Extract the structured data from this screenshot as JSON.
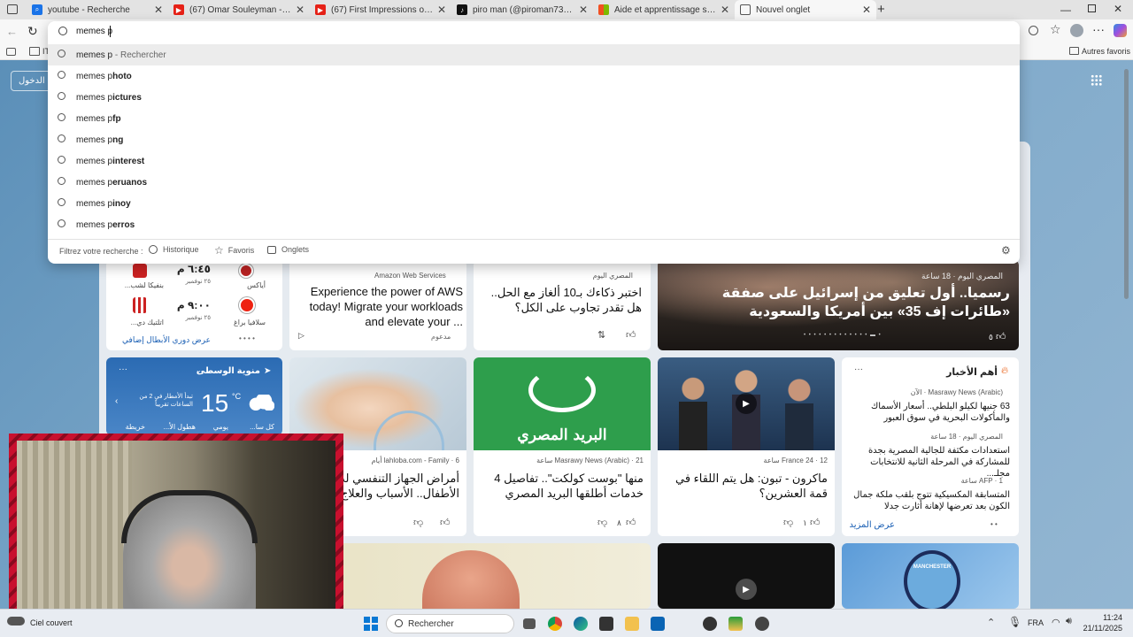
{
  "tabs": [
    {
      "title": "youtube - Recherche",
      "icon": "search-icon",
      "color": "#1a73e8"
    },
    {
      "title": "(67) Omar Souleyman - Warni Wa",
      "icon": "youtube-icon",
      "color": "#e62117"
    },
    {
      "title": "(67) First Impressions of TUNIS, T",
      "icon": "youtube-icon",
      "color": "#e62117"
    },
    {
      "title": "piro man (@piroman731) | TikTok",
      "icon": "tiktok-icon",
      "color": "#111111"
    },
    {
      "title": "Aide et apprentissage sur Micros",
      "icon": "microsoft-icon",
      "color": "#f25022"
    },
    {
      "title": "Nouvel onglet",
      "icon": "newtab-icon",
      "color": "#555555"
    }
  ],
  "address": {
    "value": "memes p"
  },
  "favbar": {
    "left": "IT",
    "right": "Autres favoris"
  },
  "omnibox": {
    "suggestions": [
      {
        "typed": "memes p",
        "rest": " - Rechercher",
        "bold": false
      },
      {
        "typed": "memes p",
        "rest": "hoto",
        "bold": true
      },
      {
        "typed": "memes p",
        "rest": "ictures",
        "bold": true
      },
      {
        "typed": "memes p",
        "rest": "fp",
        "bold": true
      },
      {
        "typed": "memes p",
        "rest": "ng",
        "bold": true
      },
      {
        "typed": "memes p",
        "rest": "interest",
        "bold": true
      },
      {
        "typed": "memes p",
        "rest": "eruanos",
        "bold": true
      },
      {
        "typed": "memes p",
        "rest": "inoy",
        "bold": true
      },
      {
        "typed": "memes p",
        "rest": "erros",
        "bold": true
      }
    ],
    "filter_label": "Filtrez votre recherche :",
    "filters": [
      "Historique",
      "Favoris",
      "Onglets"
    ]
  },
  "login": "تسجيل الدخول",
  "sports": {
    "matches": [
      {
        "time": "٦:٤٥ م",
        "date": "٢٥ نوفمبر",
        "home": "أياكس",
        "away": "بنفيكا لشب..."
      },
      {
        "time": "٩:٠٠ م",
        "date": "٢٥ نوفمبر",
        "home": "سلافيا براغ",
        "away": "اتلتيك دي..."
      }
    ],
    "more": "عرض دوري الأبطال إضافي"
  },
  "aws": {
    "source": "Amazon Web Services",
    "headline": "Experience the power of AWS today! Migrate your workloads and elevate your ...",
    "sponsored": "مدعوم"
  },
  "quiz": {
    "source": "المصري اليوم",
    "headline": "اختبر ذكاءك بـ10 ألغاز مع الحل.. هل تقدر تجاوب على الكل؟"
  },
  "hero": {
    "source": "المصري اليوم · 18 ساعة",
    "headline": "رسميا.. أول تعليق من إسرائيل على صفقة «طائرات إف 35» بين أمريكا والسعودية",
    "likes": "٥"
  },
  "weather": {
    "location": "منوية الوسطى",
    "temp": "15",
    "unit": "°C",
    "desc": "تبدأ الأمطار في 2 من الساعات تقريباً",
    "tabs": [
      "كل سا...",
      "يومي",
      "هطول الأ...",
      "خريطة"
    ]
  },
  "news1": {
    "source": "lahloba.com - Family · 6 أيام",
    "headline": "أمراض الجهاز التنفسي لدى الأطفال.. الأسباب والعلاج"
  },
  "news2": {
    "source": "Masrawy News (Arabic) · 21 ساعة",
    "headline": "منها \"بوست كولكت\".. تفاصيل 4 خدمات أطلقها البريد المصري",
    "likes": "٨",
    "logo": "البريد المصري"
  },
  "news3": {
    "source": "France 24 · 12 ساعة",
    "headline": "ماكرون - تبون: هل يتم اللقاء في قمة العشرين؟",
    "likes": "١"
  },
  "top": {
    "title": "أهم الأخبار",
    "items": [
      {
        "source": "Masrawy News (Arabic) · الآن",
        "text": "63 جنيها لكيلو البلطي.. أسعار الأسماك والمأكولات البحرية في سوق العبور"
      },
      {
        "source": "المصري اليوم · 18 ساعة",
        "text": "استعدادات مكثفة للجالية المصرية بجدة للمشاركة في المرحلة الثانية للانتخابات مجلـ..."
      },
      {
        "source": "AFP · 1 ساعة",
        "text": "المتسابقة المكسيكية تتوج بلقب ملكة جمال الكون بعد تعرضها لإهانة أثارت جدلا"
      }
    ],
    "more": "عرض المزيد"
  },
  "city_logo": "MANCHESTER",
  "taskbar": {
    "weather": "Ciel couvert",
    "search": "Rechercher",
    "lang": "FRA",
    "time": "11:24",
    "date": "21/11/2025"
  }
}
